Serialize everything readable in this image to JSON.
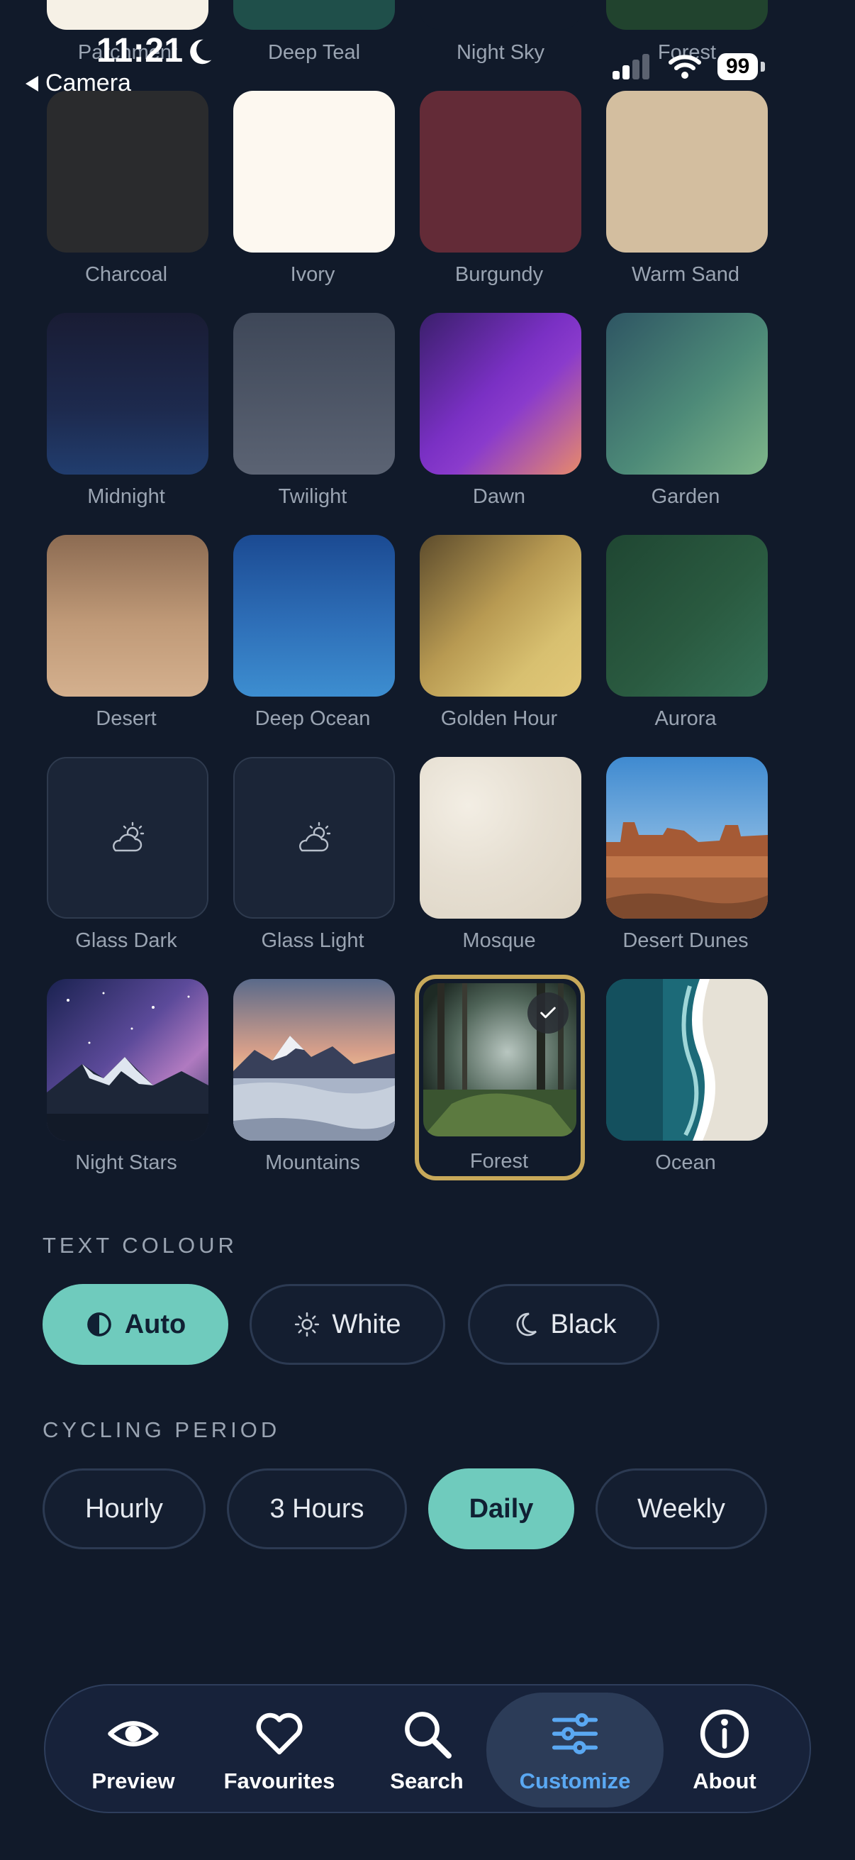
{
  "status_bar": {
    "time": "11:21",
    "back_label": "Camera",
    "battery": "99"
  },
  "top_row_labels": [
    "Parchment",
    "Deep Teal",
    "Night Sky",
    "Forest"
  ],
  "backgrounds": [
    {
      "label": "Charcoal"
    },
    {
      "label": "Ivory"
    },
    {
      "label": "Burgundy"
    },
    {
      "label": "Warm Sand"
    },
    {
      "label": "Midnight"
    },
    {
      "label": "Twilight"
    },
    {
      "label": "Dawn"
    },
    {
      "label": "Garden"
    },
    {
      "label": "Desert"
    },
    {
      "label": "Deep Ocean"
    },
    {
      "label": "Golden Hour"
    },
    {
      "label": "Aurora"
    },
    {
      "label": "Glass Dark"
    },
    {
      "label": "Glass Light"
    },
    {
      "label": "Mosque"
    },
    {
      "label": "Desert Dunes"
    },
    {
      "label": "Night Stars"
    },
    {
      "label": "Mountains"
    },
    {
      "label": "Forest",
      "selected": true
    },
    {
      "label": "Ocean"
    }
  ],
  "text_colour": {
    "title": "TEXT COLOUR",
    "options": [
      {
        "label": "Auto",
        "icon": "half-circle-icon",
        "active": true
      },
      {
        "label": "White",
        "icon": "sun-icon",
        "active": false
      },
      {
        "label": "Black",
        "icon": "moon-icon",
        "active": false
      }
    ]
  },
  "cycling_period": {
    "title": "CYCLING PERIOD",
    "options": [
      {
        "label": "Hourly",
        "active": false
      },
      {
        "label": "3 Hours",
        "active": false
      },
      {
        "label": "Daily",
        "active": true
      },
      {
        "label": "Weekly",
        "active": false
      }
    ]
  },
  "nav": {
    "items": [
      {
        "label": "Preview",
        "icon": "eye-icon"
      },
      {
        "label": "Favourites",
        "icon": "heart-icon"
      },
      {
        "label": "Search",
        "icon": "search-icon"
      },
      {
        "label": "Customize",
        "icon": "sliders-icon",
        "active": true
      },
      {
        "label": "About",
        "icon": "info-icon"
      }
    ]
  },
  "colors": {
    "background": "#111a2a",
    "accent_teal": "#6fcbbd",
    "selected_border": "#c8a95a",
    "nav_active_text": "#5aa8f2"
  }
}
